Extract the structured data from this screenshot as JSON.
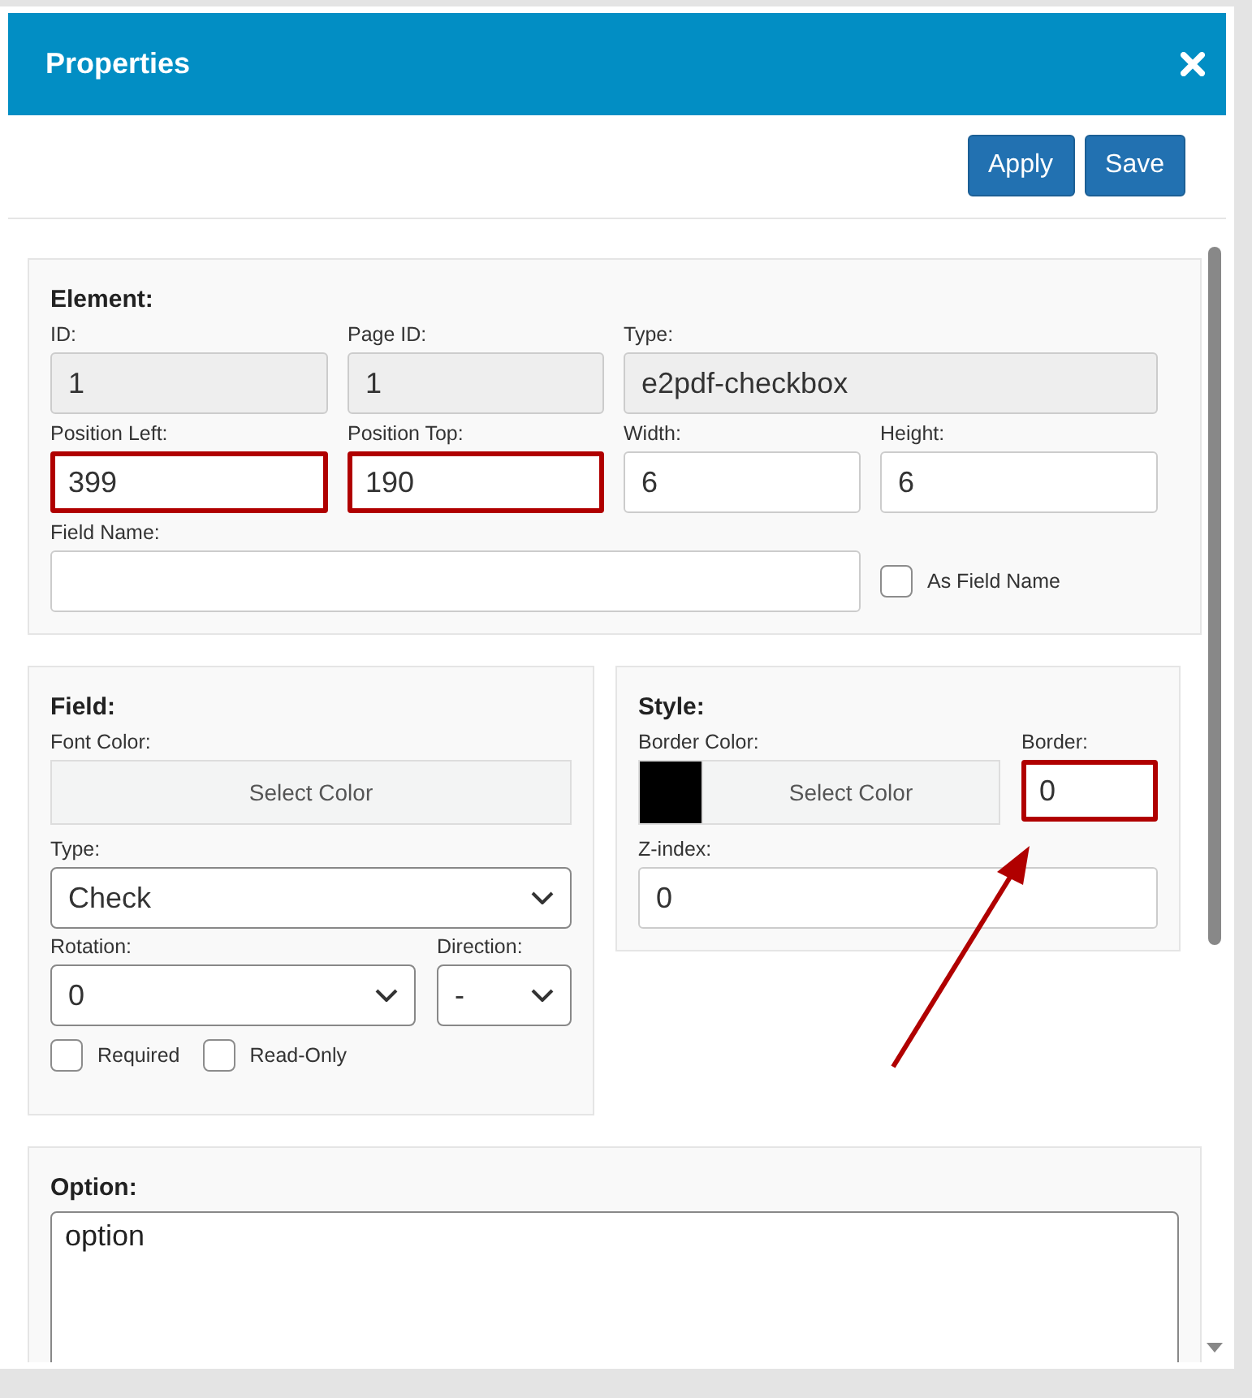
{
  "dialog": {
    "title": "Properties"
  },
  "toolbar": {
    "buttons": [
      "Apply",
      "Save"
    ]
  },
  "element": {
    "title": "Element:",
    "fields": [
      {
        "label": "ID:",
        "value": "1",
        "disabled": true,
        "highlighted": false
      },
      {
        "label": "Page ID:",
        "value": "1",
        "disabled": true,
        "highlighted": false
      },
      {
        "label": "Type:",
        "value": "e2pdf-checkbox",
        "disabled": true,
        "highlighted": false
      },
      {
        "label": "Position Left:",
        "value": "399",
        "disabled": false,
        "highlighted": true
      },
      {
        "label": "Position Top:",
        "value": "190",
        "disabled": false,
        "highlighted": true
      },
      {
        "label": "Width:",
        "value": "6",
        "disabled": false,
        "highlighted": false
      },
      {
        "label": "Height:",
        "value": "6",
        "disabled": false,
        "highlighted": false
      }
    ],
    "field_name": {
      "label": "Field Name:"
    },
    "as_field_name": {
      "label": "As Field Name",
      "checked": false
    }
  },
  "field": {
    "title": "Field:",
    "font_color": {
      "label": "Font Color:",
      "button": "Select Color",
      "swatch": false
    },
    "type": {
      "label": "Type:",
      "value": "Check"
    },
    "rotation": {
      "label": "Rotation:",
      "value": "0"
    },
    "direction": {
      "label": "Direction:",
      "value": "-"
    },
    "checkboxes": [
      {
        "label": "Required",
        "checked": false
      },
      {
        "label": "Read-Only",
        "checked": false
      }
    ]
  },
  "style": {
    "title": "Style:",
    "border_color": {
      "label": "Border Color:",
      "button": "Select Color",
      "swatch": true
    },
    "border": {
      "label": "Border:",
      "value": "0",
      "highlighted": true
    },
    "z_index": {
      "label": "Z-index:",
      "value": "0",
      "highlighted": false
    }
  },
  "option": {
    "title": "Option:",
    "value": "option"
  }
}
